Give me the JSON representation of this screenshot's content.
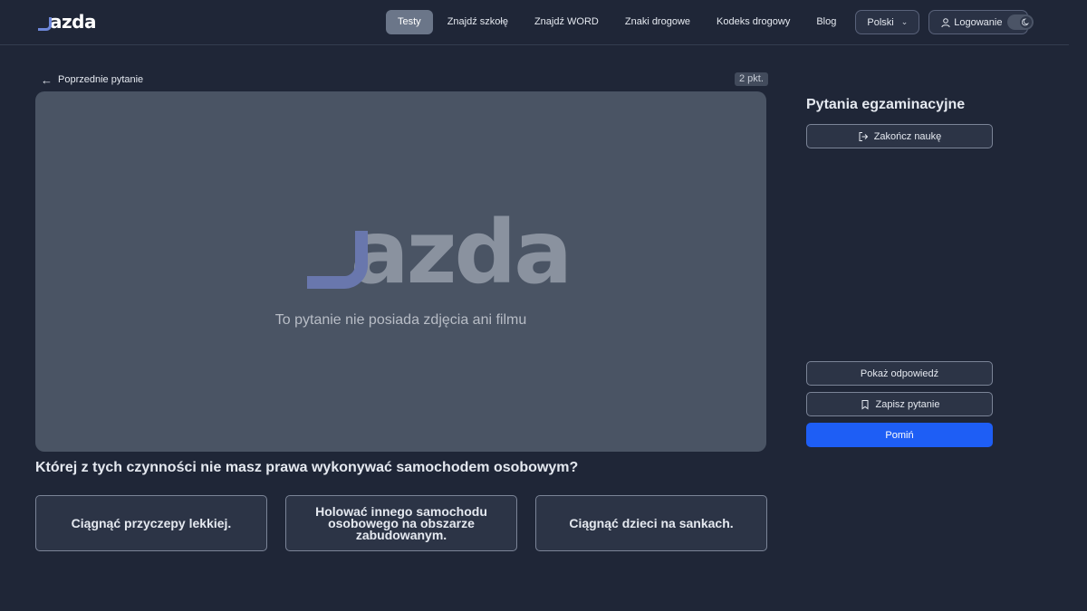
{
  "header": {
    "logo_text": "azda",
    "nav": [
      {
        "label": "Testy",
        "active": true
      },
      {
        "label": "Znajdź szkołę"
      },
      {
        "label": "Znajdź WORD"
      },
      {
        "label": "Znaki drogowe"
      },
      {
        "label": "Kodeks drogowy"
      },
      {
        "label": "Blog"
      }
    ],
    "language": "Polski",
    "login": "Logowanie"
  },
  "main": {
    "previous_label": "Poprzednie pytanie",
    "points": "2 pkt.",
    "media_logo_text": "azda",
    "media_caption": "To pytanie nie posiada zdjęcia ani filmu",
    "question": "Której z tych czynności nie masz prawa wykonywać samochodem osobowym?",
    "answers": [
      "Ciągnąć przyczepy lekkiej.",
      "Holować innego samochodu osobowego na obszarze zabudowanym.",
      "Ciągnąć dzieci na sankach."
    ]
  },
  "sidebar": {
    "title": "Pytania egzaminacyjne",
    "finish_label": "Zakończ naukę",
    "show_answer_label": "Pokaż odpowiedź",
    "save_label": "Zapisz pytanie",
    "skip_label": "Pomiń"
  },
  "colors": {
    "background": "#1f2637",
    "accent": "#1e5ef5",
    "logo_mark": "#6d86d8"
  }
}
